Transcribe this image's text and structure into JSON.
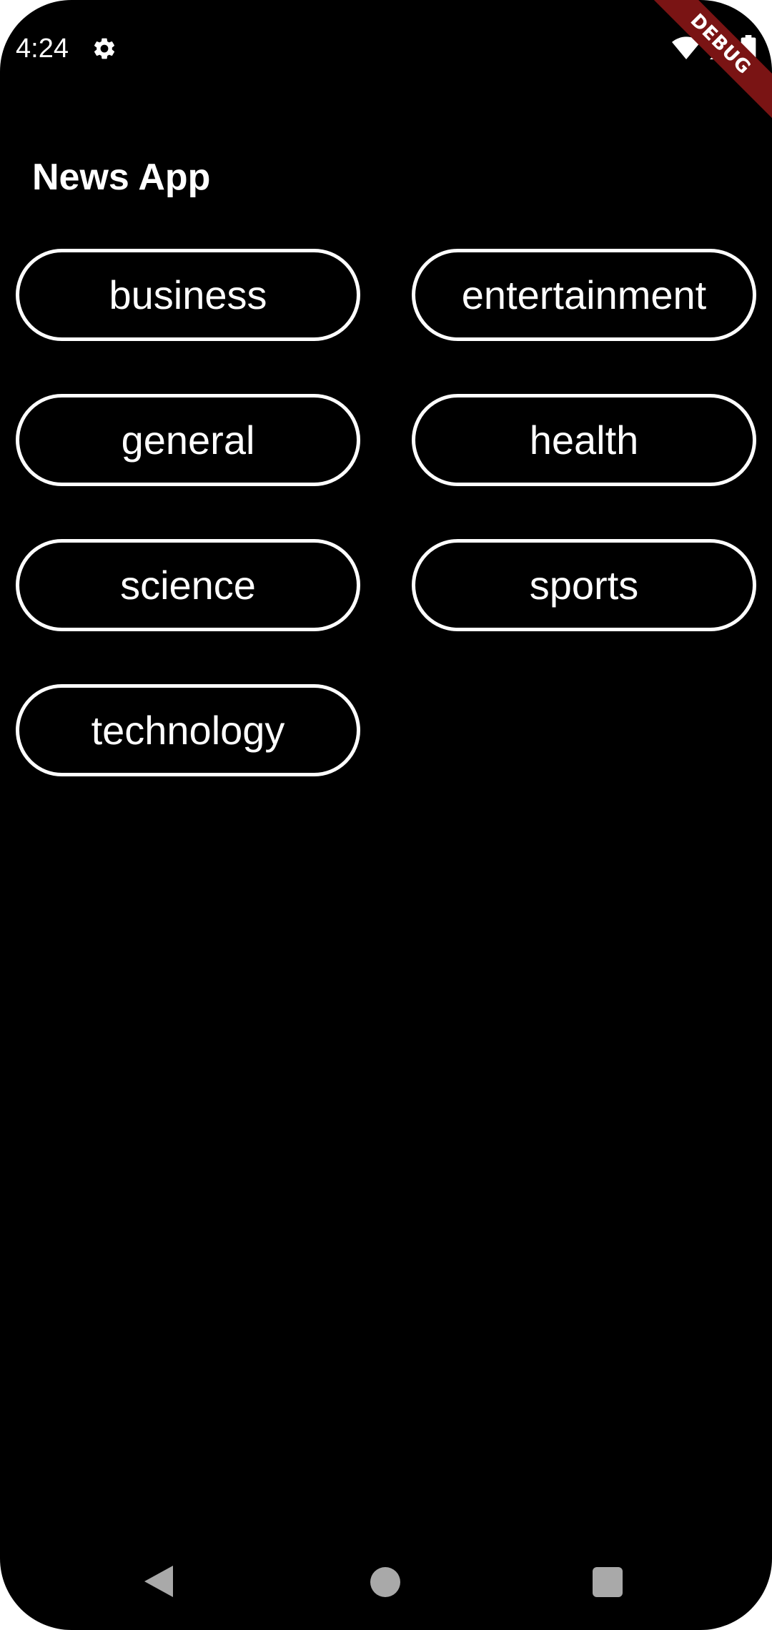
{
  "status_bar": {
    "time": "4:24",
    "icons": [
      "settings-gear-icon",
      "wifi-icon",
      "signal-icon",
      "battery-icon"
    ]
  },
  "debug_banner": "DEBUG",
  "app_bar": {
    "title": "News App"
  },
  "categories": [
    {
      "label": "business"
    },
    {
      "label": "entertainment"
    },
    {
      "label": "general"
    },
    {
      "label": "health"
    },
    {
      "label": "science"
    },
    {
      "label": "sports"
    },
    {
      "label": "technology"
    }
  ],
  "navigation_bar": {
    "icons": [
      "back-icon",
      "home-icon",
      "recents-icon"
    ]
  },
  "colors": {
    "background": "#000000",
    "foreground": "#ffffff",
    "debug_ribbon": "#7a1414",
    "nav_icons": "#a9a9a9"
  }
}
